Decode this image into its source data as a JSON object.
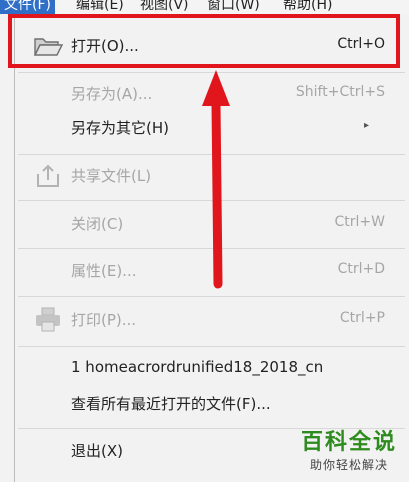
{
  "menubar": {
    "items": [
      {
        "label": "文件(F)",
        "active": true
      },
      {
        "label": "编辑(E)"
      },
      {
        "label": "视图(V)"
      },
      {
        "label": "窗口(W)"
      },
      {
        "label": "帮助(H)"
      }
    ]
  },
  "menu": {
    "items": [
      {
        "label": "打开(O)...",
        "shortcut": "Ctrl+O",
        "icon": "folder-open-icon",
        "enabled": true
      },
      {
        "label": "另存为(A)...",
        "shortcut": "Shift+Ctrl+S",
        "enabled": false
      },
      {
        "label": "另存为其它(H)",
        "submenu_arrow": "▸",
        "enabled": true
      },
      {
        "label": "共享文件(L)",
        "icon": "share-icon",
        "enabled": false
      },
      {
        "label": "关闭(C)",
        "shortcut": "Ctrl+W",
        "enabled": false
      },
      {
        "label": "属性(E)...",
        "shortcut": "Ctrl+D",
        "enabled": false
      },
      {
        "label": "打印(P)...",
        "shortcut": "Ctrl+P",
        "icon": "printer-icon",
        "enabled": false
      },
      {
        "label": "1 homeacrordrunified18_2018_cn",
        "enabled": true
      },
      {
        "label": "查看所有最近打开的文件(F)...",
        "enabled": true
      },
      {
        "label": "退出(X)",
        "enabled": true
      }
    ]
  },
  "annotation": {
    "color": "#e0161c"
  },
  "watermark": {
    "title": "百科全说",
    "subtitle": "助你轻松解决"
  }
}
